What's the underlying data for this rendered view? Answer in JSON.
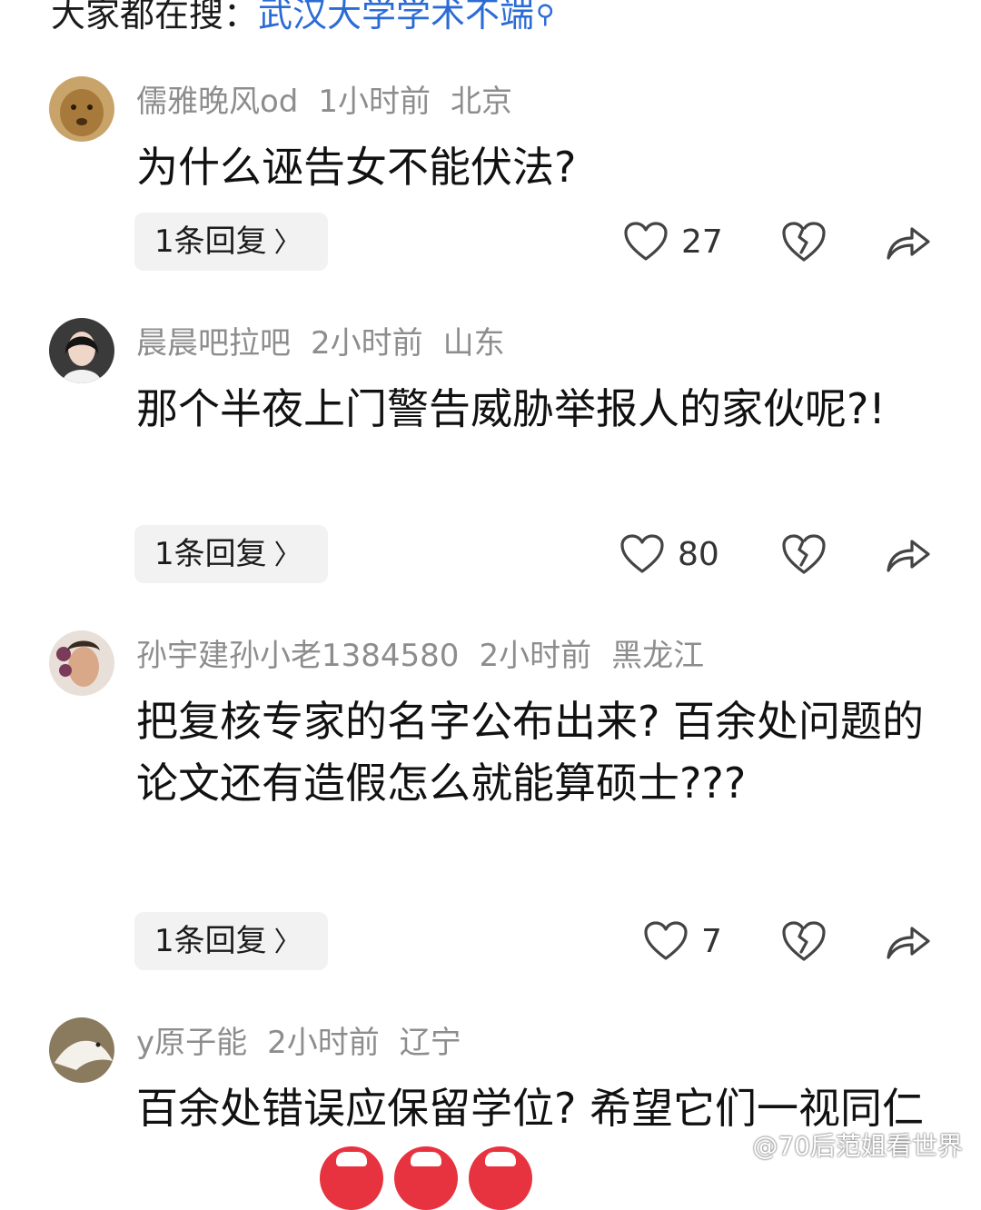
{
  "search_hint": {
    "prefix": "大家都在搜：",
    "term": "武汉大学学术不端"
  },
  "comments": [
    {
      "user": "儒雅晚风od",
      "time": "1小时前",
      "location": "北京",
      "text": "为什么诬告女不能伏法?",
      "reply_label": "1条回复",
      "likes": "27"
    },
    {
      "user": "晨晨吧拉吧",
      "time": "2小时前",
      "location": "山东",
      "text": "那个半夜上门警告威胁举报人的家伙呢?!",
      "reply_label": "1条回复",
      "likes": "80"
    },
    {
      "user": "孙宇建孙小老1384580",
      "time": "2小时前",
      "location": "黑龙江",
      "text": "把复核专家的名字公布出来? 百余处问题的论文还有造假怎么就能算硕士???",
      "reply_label": "1条回复",
      "likes": "7"
    },
    {
      "user": "y原子能",
      "time": "2小时前",
      "location": "辽宁",
      "text": "百余处错误应保留学位? 希望它们一视同仁",
      "reply_label": "",
      "likes": ""
    }
  ],
  "watermark": "@70后范姐看世界",
  "icons": {
    "like": "heart-outline-icon",
    "dislike": "broken-heart-icon",
    "share": "share-arrow-icon",
    "reply_chevron": "chevron-right-icon",
    "search": "search-icon"
  },
  "colors": {
    "link": "#2b6bd6",
    "meta": "#8d8d8d",
    "text": "#111111",
    "reply_bg": "#f2f2f2"
  }
}
